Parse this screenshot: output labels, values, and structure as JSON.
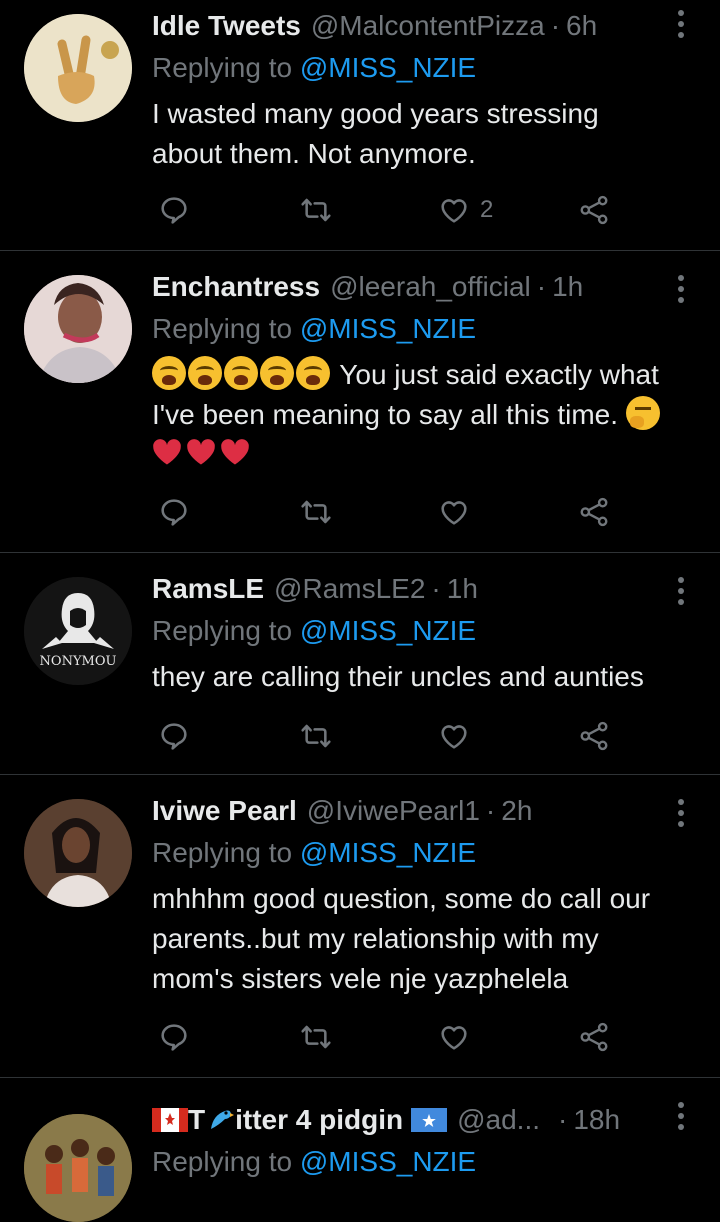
{
  "tweets": [
    {
      "name": "Idle Tweets",
      "handle": "@MalcontentPizza",
      "time": "6h",
      "replying_prefix": "Replying to",
      "mention": "@MISS_NZIE",
      "text_lines": [
        "I wasted many good years stressing",
        "about them. Not anymore."
      ],
      "like_count": "2"
    },
    {
      "name": "Enchantress",
      "handle": "@leerah_official",
      "time": "1h",
      "replying_prefix": "Replying to",
      "mention": "@MISS_NZIE",
      "text_line1": "You just said exactly what",
      "text_line2": "I've been meaning to say all this time.",
      "emojis": [
        "weary-face",
        "weary-face",
        "weary-face",
        "weary-face",
        "weary-face",
        "thinking-face",
        "red-heart",
        "red-heart",
        "red-heart"
      ]
    },
    {
      "name": "RamsLE",
      "handle": "@RamsLE2",
      "time": "1h",
      "replying_prefix": "Replying to",
      "mention": "@MISS_NZIE",
      "text_lines": [
        "they are calling their uncles and aunties"
      ],
      "avatar_text": "NONYMOU"
    },
    {
      "name": "Iviwe Pearl",
      "handle": "@IviwePearl1",
      "time": "2h",
      "replying_prefix": "Replying to",
      "mention": "@MISS_NZIE",
      "text_lines": [
        "mhhhm good question, some do call our",
        "parents..but my relationship with my",
        "mom's sisters vele nje yazphelela"
      ]
    },
    {
      "name_part1": "T",
      "name_part2": "itter 4 pidgin",
      "handle": "@ad...",
      "time": "18h",
      "replying_prefix": "Replying to",
      "mention": "@MISS_NZIE"
    }
  ],
  "separator": "·",
  "icons": [
    "reply-icon",
    "retweet-icon",
    "like-icon",
    "share-icon",
    "more-icon"
  ],
  "colors": {
    "background": "#000000",
    "text": "#e7e9ea",
    "secondary": "#71767b",
    "accent": "#1d9bf0",
    "divider": "#2f3336"
  }
}
